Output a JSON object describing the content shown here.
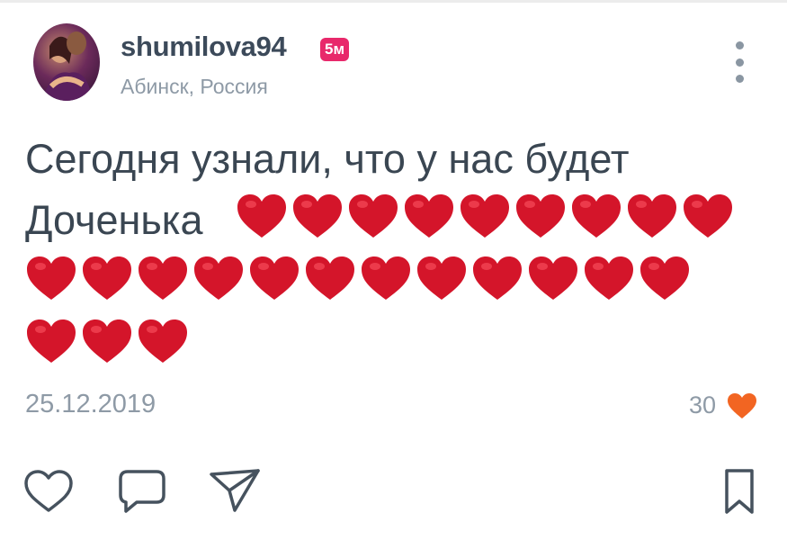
{
  "post": {
    "username": "shumilova94",
    "badge": "5м",
    "location": "Абинск, Россия",
    "text_line1": "Сегодня узнали, что у нас будет",
    "text_line2": "Доченька",
    "heart_emoji_count": 24,
    "date": "25.12.2019",
    "likes": "30"
  },
  "colors": {
    "accent_badge": "#e8286b",
    "like_heart": "#f26522",
    "emoji_heart": "#d4152a"
  },
  "icons": {
    "menu": "more-vertical-icon",
    "like": "heart-icon",
    "comment": "comment-icon",
    "share": "send-icon",
    "bookmark": "bookmark-icon"
  }
}
